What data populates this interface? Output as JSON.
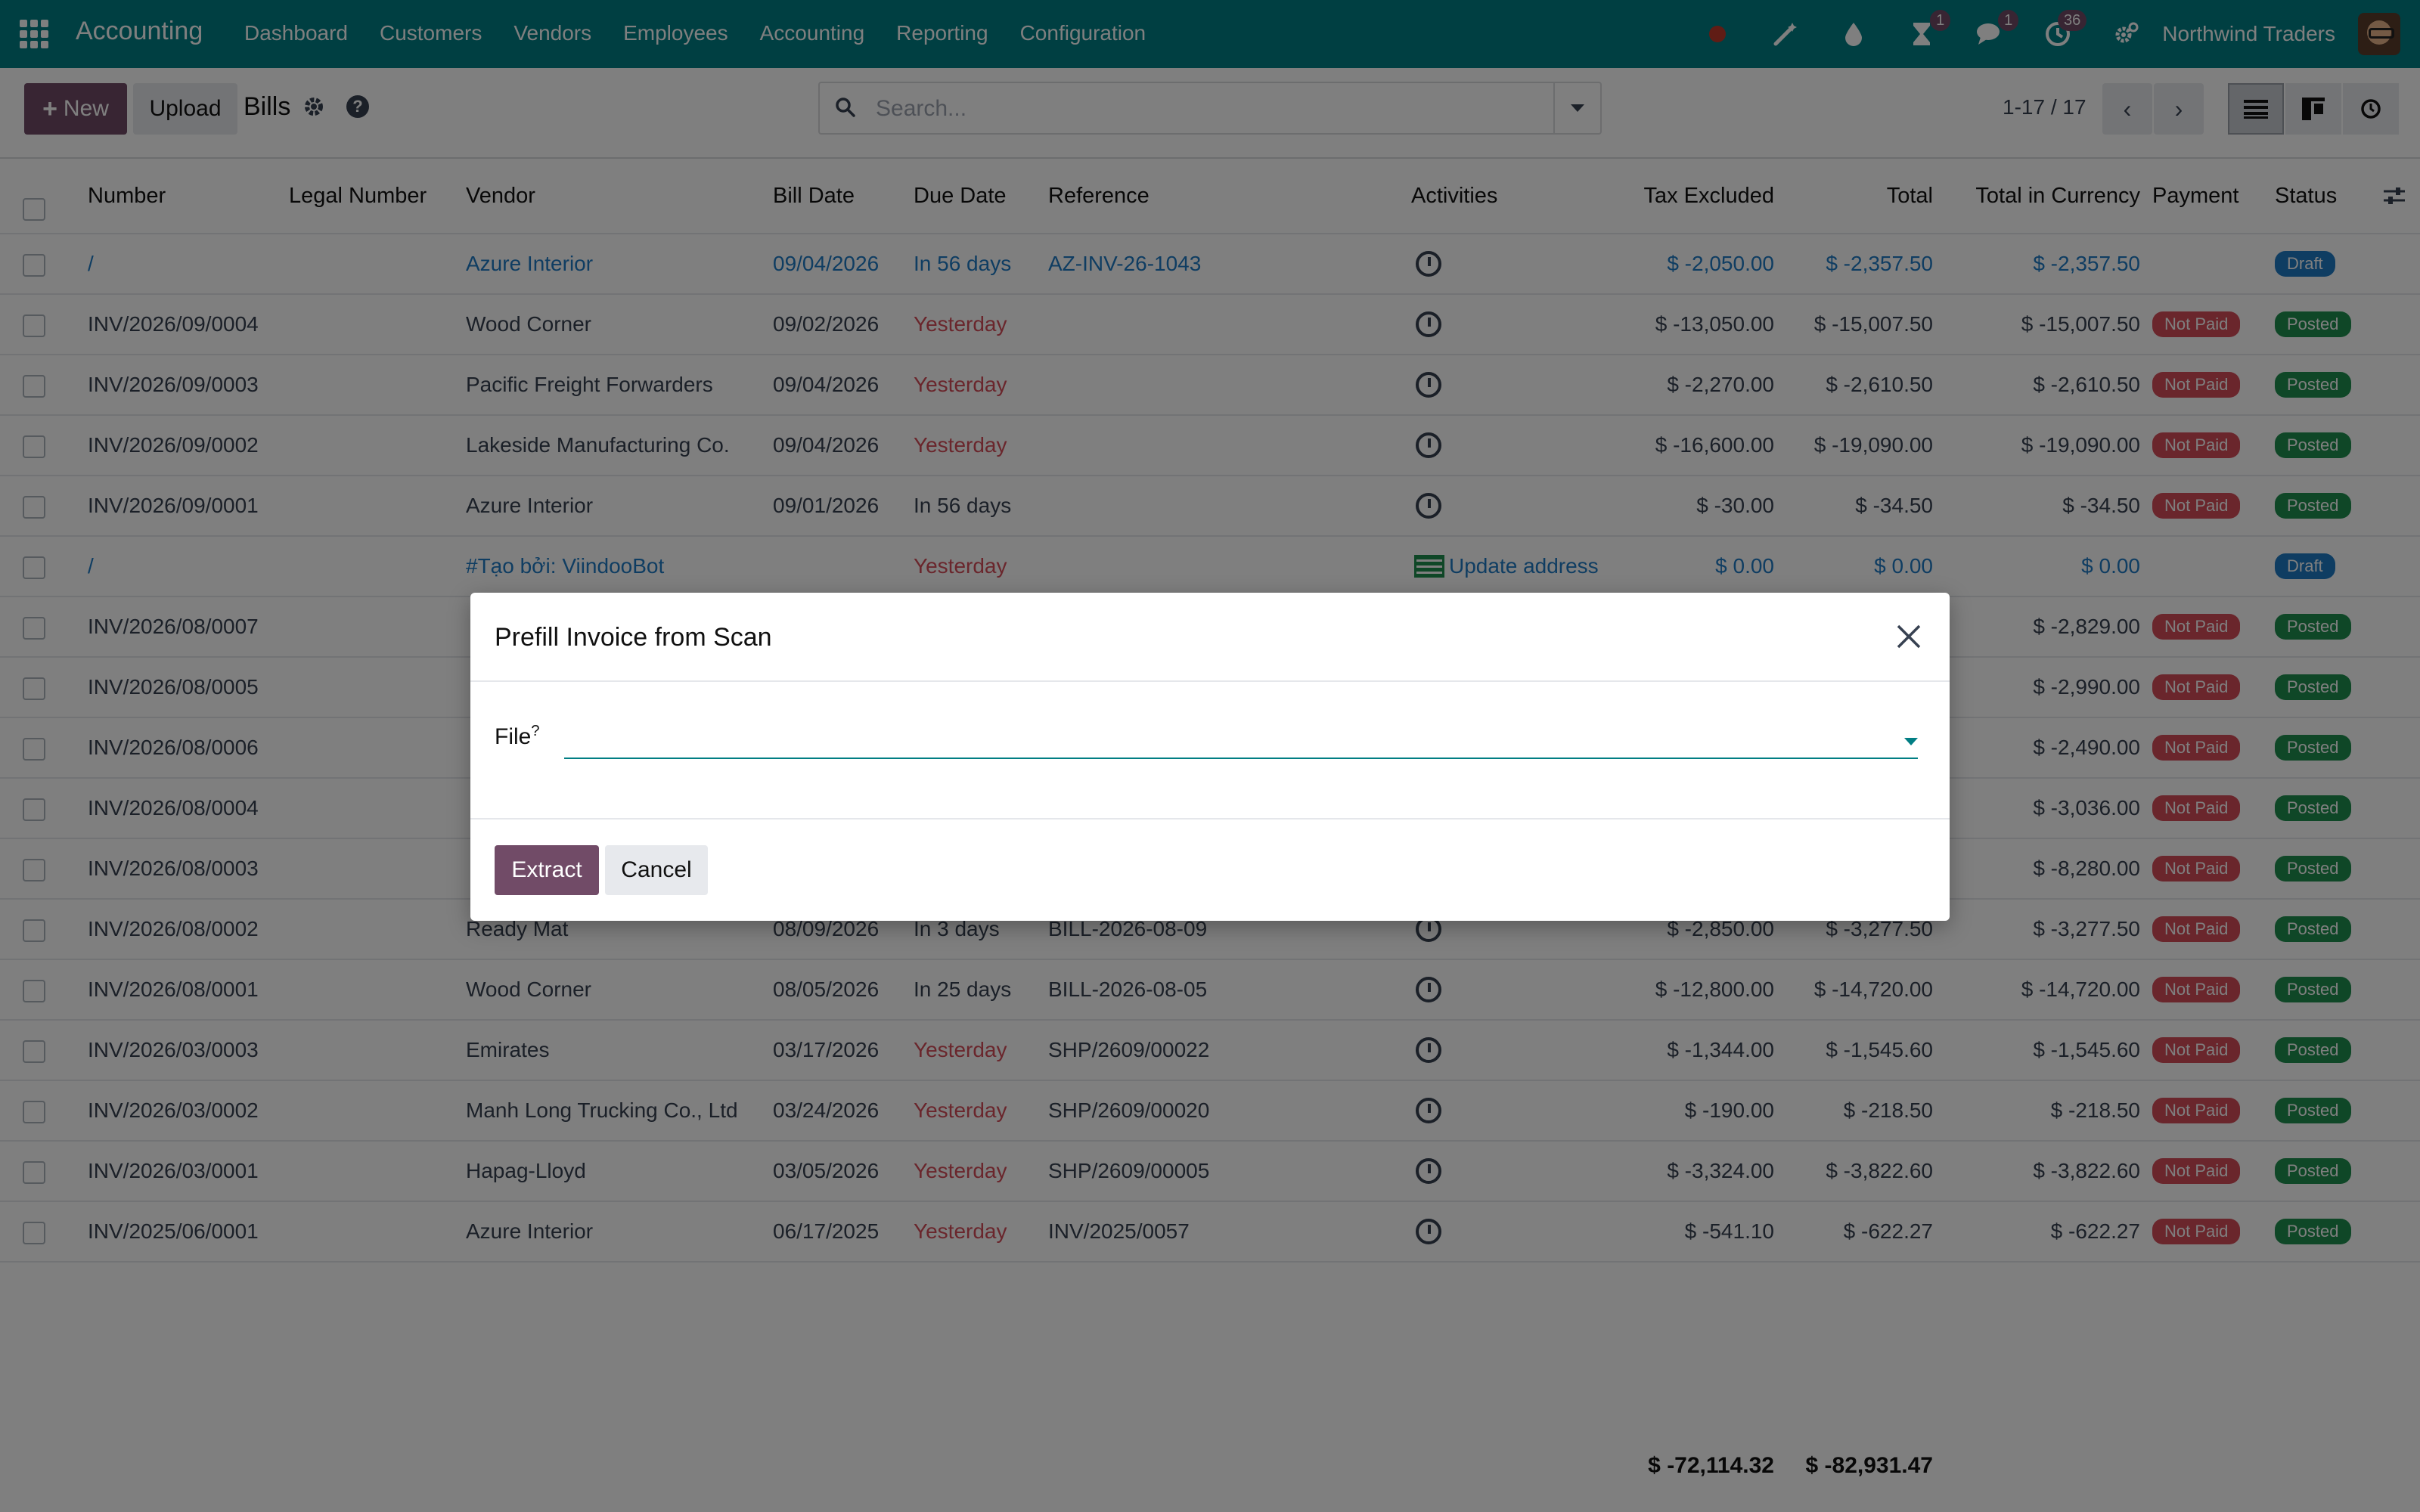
{
  "topbar": {
    "app_name": "Accounting",
    "menu": [
      "Dashboard",
      "Customers",
      "Vendors",
      "Employees",
      "Accounting",
      "Reporting",
      "Configuration"
    ],
    "badges": {
      "activity": "1",
      "messages": "1",
      "updates": "36"
    },
    "company": "Northwind Traders",
    "color": "#017e84"
  },
  "control": {
    "new_label": "New",
    "upload_label": "Upload",
    "breadcrumb": "Bills",
    "search_placeholder": "Search...",
    "pager": "1-17 / 17"
  },
  "table": {
    "headers": [
      "Number",
      "Legal Number",
      "Vendor",
      "Bill Date",
      "Due Date",
      "Reference",
      "Activities",
      "Tax Excluded",
      "Total",
      "Total in Currency",
      "Payment",
      "Status"
    ],
    "rows": [
      {
        "number": "/",
        "vendor": "Azure Interior",
        "bill_date": "09/04/2026",
        "due": "In 56 days",
        "ref": "AZ-INV-26-1043",
        "activity": "clock",
        "tax": "$ -2,050.00",
        "total": "$ -2,357.50",
        "cur": "$ -2,357.50",
        "payment": "",
        "status": "Draft",
        "draft": true
      },
      {
        "number": "INV/2026/09/0004",
        "vendor": "Wood Corner",
        "bill_date": "09/02/2026",
        "due": "Yesterday",
        "ref": "",
        "activity": "clock",
        "tax": "$ -13,050.00",
        "total": "$ -15,007.50",
        "cur": "$ -15,007.50",
        "payment": "Not Paid",
        "status": "Posted"
      },
      {
        "number": "INV/2026/09/0003",
        "vendor": "Pacific Freight Forwarders",
        "bill_date": "09/04/2026",
        "due": "Yesterday",
        "ref": "",
        "activity": "clock",
        "tax": "$ -2,270.00",
        "total": "$ -2,610.50",
        "cur": "$ -2,610.50",
        "payment": "Not Paid",
        "status": "Posted"
      },
      {
        "number": "INV/2026/09/0002",
        "vendor": "Lakeside Manufacturing Co.",
        "bill_date": "09/04/2026",
        "due": "Yesterday",
        "ref": "",
        "activity": "clock",
        "tax": "$ -16,600.00",
        "total": "$ -19,090.00",
        "cur": "$ -19,090.00",
        "payment": "Not Paid",
        "status": "Posted"
      },
      {
        "number": "INV/2026/09/0001",
        "vendor": "Azure Interior",
        "bill_date": "09/01/2026",
        "due": "In 56 days",
        "ref": "",
        "activity": "clock",
        "tax": "$ -30.00",
        "total": "$ -34.50",
        "cur": "$ -34.50",
        "payment": "Not Paid",
        "status": "Posted"
      },
      {
        "number": "/",
        "vendor": "#Tạo bởi: ViindooBot",
        "bill_date": "",
        "due": "Yesterday",
        "ref": "",
        "activity": "Update address",
        "tax": "$ 0.00",
        "total": "$ 0.00",
        "cur": "$ 0.00",
        "payment": "",
        "status": "Draft",
        "draft": true
      },
      {
        "number": "INV/2026/08/0007",
        "vendor": "",
        "bill_date": "",
        "due": "",
        "ref": "",
        "activity": "",
        "tax": "",
        "total": "",
        "cur": "$ -2,829.00",
        "payment": "Not Paid",
        "status": "Posted"
      },
      {
        "number": "INV/2026/08/0005",
        "vendor": "",
        "bill_date": "",
        "due": "",
        "ref": "",
        "activity": "",
        "tax": "",
        "total": "",
        "cur": "$ -2,990.00",
        "payment": "Not Paid",
        "status": "Posted"
      },
      {
        "number": "INV/2026/08/0006",
        "vendor": "",
        "bill_date": "",
        "due": "",
        "ref": "",
        "activity": "",
        "tax": "",
        "total": "",
        "cur": "$ -2,490.00",
        "payment": "Not Paid",
        "status": "Posted"
      },
      {
        "number": "INV/2026/08/0004",
        "vendor": "",
        "bill_date": "",
        "due": "",
        "ref": "",
        "activity": "",
        "tax": "",
        "total": "",
        "cur": "$ -3,036.00",
        "payment": "Not Paid",
        "status": "Posted"
      },
      {
        "number": "INV/2026/08/0003",
        "vendor": "",
        "bill_date": "",
        "due": "",
        "ref": "",
        "activity": "",
        "tax": "",
        "total": "",
        "cur": "$ -8,280.00",
        "payment": "Not Paid",
        "status": "Posted"
      },
      {
        "number": "INV/2026/08/0002",
        "vendor": "Ready Mat",
        "bill_date": "08/09/2026",
        "due": "In 3 days",
        "ref": "BILL-2026-08-09",
        "activity": "clock",
        "tax": "$ -2,850.00",
        "total": "$ -3,277.50",
        "cur": "$ -3,277.50",
        "payment": "Not Paid",
        "status": "Posted"
      },
      {
        "number": "INV/2026/08/0001",
        "vendor": "Wood Corner",
        "bill_date": "08/05/2026",
        "due": "In 25 days",
        "ref": "BILL-2026-08-05",
        "activity": "clock",
        "tax": "$ -12,800.00",
        "total": "$ -14,720.00",
        "cur": "$ -14,720.00",
        "payment": "Not Paid",
        "status": "Posted"
      },
      {
        "number": "INV/2026/03/0003",
        "vendor": "Emirates",
        "bill_date": "03/17/2026",
        "due": "Yesterday",
        "ref": "SHP/2609/00022",
        "activity": "clock",
        "tax": "$ -1,344.00",
        "total": "$ -1,545.60",
        "cur": "$ -1,545.60",
        "payment": "Not Paid",
        "status": "Posted"
      },
      {
        "number": "INV/2026/03/0002",
        "vendor": "Manh Long Trucking Co., Ltd",
        "bill_date": "03/24/2026",
        "due": "Yesterday",
        "ref": "SHP/2609/00020",
        "activity": "clock",
        "tax": "$ -190.00",
        "total": "$ -218.50",
        "cur": "$ -218.50",
        "payment": "Not Paid",
        "status": "Posted"
      },
      {
        "number": "INV/2026/03/0001",
        "vendor": "Hapag-Lloyd",
        "bill_date": "03/05/2026",
        "due": "Yesterday",
        "ref": "SHP/2609/00005",
        "activity": "clock",
        "tax": "$ -3,324.00",
        "total": "$ -3,822.60",
        "cur": "$ -3,822.60",
        "payment": "Not Paid",
        "status": "Posted"
      },
      {
        "number": "INV/2025/06/0001",
        "vendor": "Azure Interior",
        "bill_date": "06/17/2025",
        "due": "Yesterday",
        "ref": "INV/2025/0057",
        "activity": "clock",
        "tax": "$ -541.10",
        "total": "$ -622.27",
        "cur": "$ -622.27",
        "payment": "Not Paid",
        "status": "Posted"
      }
    ],
    "sum_tax": "$ -72,114.32",
    "sum_total": "$ -82,931.47"
  },
  "modal": {
    "title": "Prefill Invoice from Scan",
    "file_label": "File",
    "file_help": "?",
    "file_value": "",
    "extract_label": "Extract",
    "cancel_label": "Cancel"
  }
}
